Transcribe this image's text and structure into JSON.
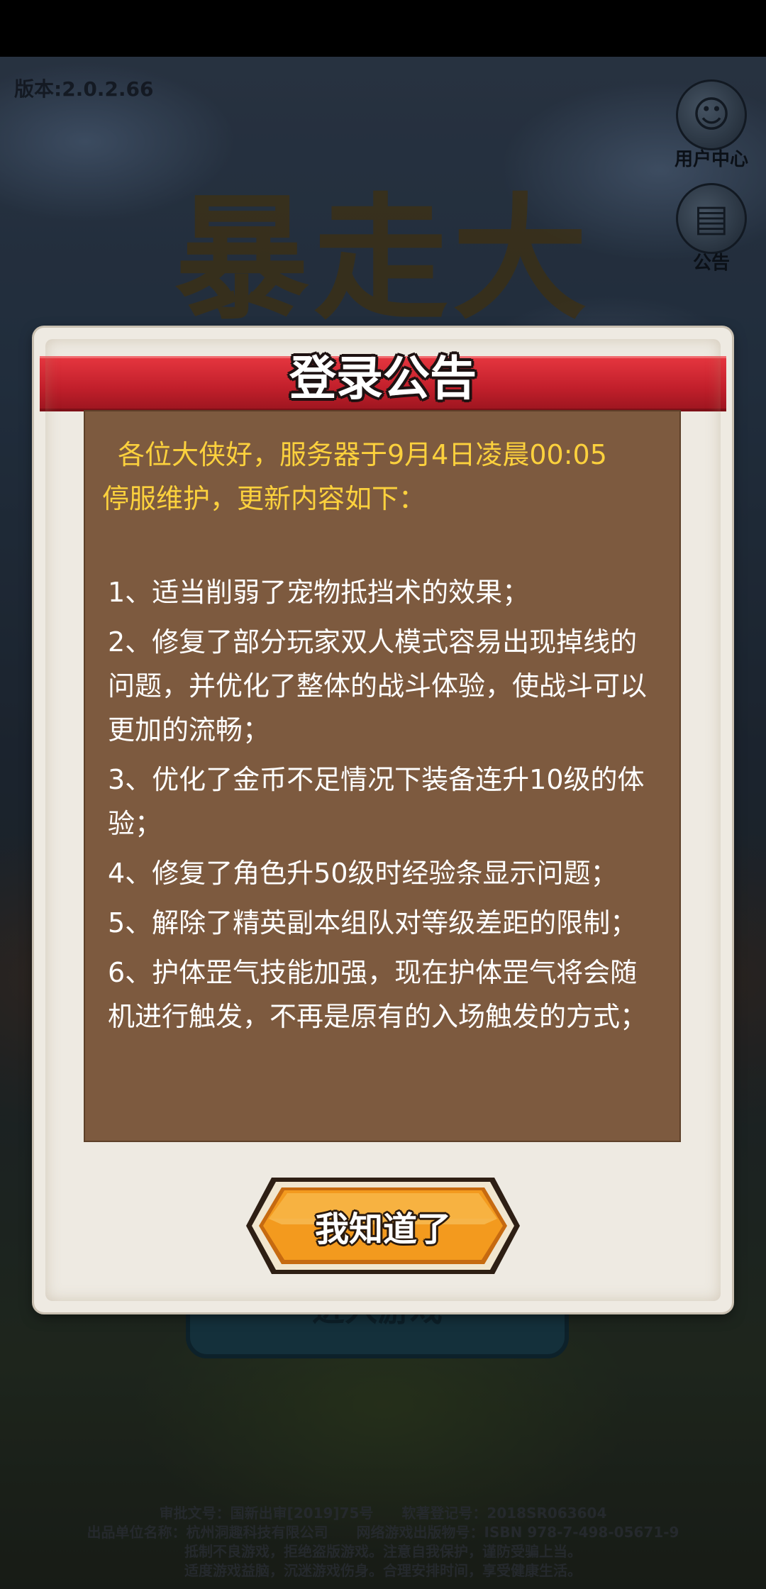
{
  "app": {
    "version_text": "版本:2.0.2.66",
    "game_title_art": "暴走大侠",
    "side_buttons": [
      {
        "label": "用户中心",
        "icon": "user-avatar-icon"
      },
      {
        "label": "公告",
        "icon": "notice-board-icon"
      }
    ],
    "enter_game_label": "进入游戏",
    "legal_lines": [
      "审批文号：国新出审[2019]75号　　软著登记号：2018SR063604",
      "出品单位名称：杭州洞趣科技有限公司　　网络游戏出版物号：ISBN 978-7-498-05671-9",
      "抵制不良游戏，拒绝盗版游戏。注意自我保护，谨防受骗上当。",
      "适度游戏益脑，沉迷游戏伤身。合理安排时间，享受健康生活。"
    ]
  },
  "dialog": {
    "title": "登录公告",
    "intro_line1": "各位大侠好，服务器于9月4日凌晨00:05",
    "intro_line2": "停服维护，更新内容如下：",
    "items": [
      "1、适当削弱了宠物抵挡术的效果；",
      "2、修复了部分玩家双人模式容易出现掉线的问题，并优化了整体的战斗体验，使战斗可以更加的流畅；",
      "3、优化了金币不足情况下装备连升10级的体验；",
      "4、修复了角色升50级时经验条显示问题；",
      "5、解除了精英副本组队对等级差距的限制；",
      "6、护体罡气技能加强，现在护体罡气将会随机进行触发，不再是原有的入场触发的方式；"
    ],
    "confirm_label": "我知道了"
  },
  "colors": {
    "ribbon_red": "#c11f2b",
    "panel_brown": "#7d5a3f",
    "intro_yellow": "#fcd13d",
    "button_orange": "#f39a1e"
  }
}
